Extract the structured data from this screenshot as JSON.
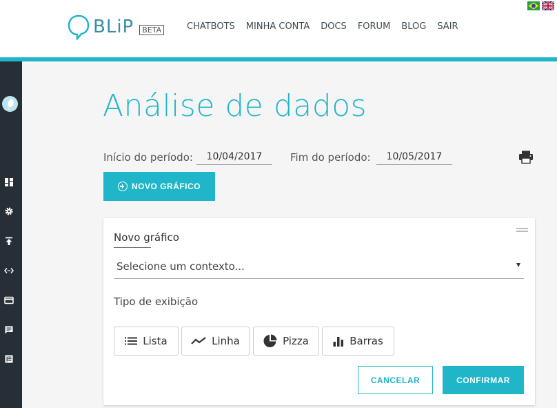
{
  "header": {
    "logo_text": "BLiP",
    "beta_label": "BETA",
    "nav": [
      "CHATBOTS",
      "MINHA CONTA",
      "DOCS",
      "FORUM",
      "BLOG",
      "SAIR"
    ],
    "flags": [
      "brazil-flag-icon",
      "uk-flag-icon"
    ]
  },
  "sidebar": {
    "icons": [
      "avatar",
      "dashboard-icon",
      "gear-icon",
      "upload-icon",
      "code-icon",
      "card-icon",
      "chat-icon",
      "book-icon"
    ]
  },
  "main": {
    "title": "Análise de dados",
    "period_start_label": "Início do período:",
    "period_start_value": "10/04/2017",
    "period_end_label": "Fim do período:",
    "period_end_value": "10/05/2017",
    "new_chart_label": "NOVO GRÁFICO"
  },
  "card": {
    "title": "Novo gráfico",
    "context_placeholder": "Selecione um contexto...",
    "display_type_label": "Tipo de exibição",
    "display_types": [
      {
        "label": "Lista",
        "icon": "list-icon"
      },
      {
        "label": "Linha",
        "icon": "line-chart-icon"
      },
      {
        "label": "Pizza",
        "icon": "pie-chart-icon"
      },
      {
        "label": "Barras",
        "icon": "bar-chart-icon"
      }
    ],
    "cancel_label": "CANCELAR",
    "confirm_label": "CONFIRMAR"
  },
  "colors": {
    "accent": "#1fb6c9",
    "sidebar": "#262f36",
    "background": "#f5f5f5"
  }
}
